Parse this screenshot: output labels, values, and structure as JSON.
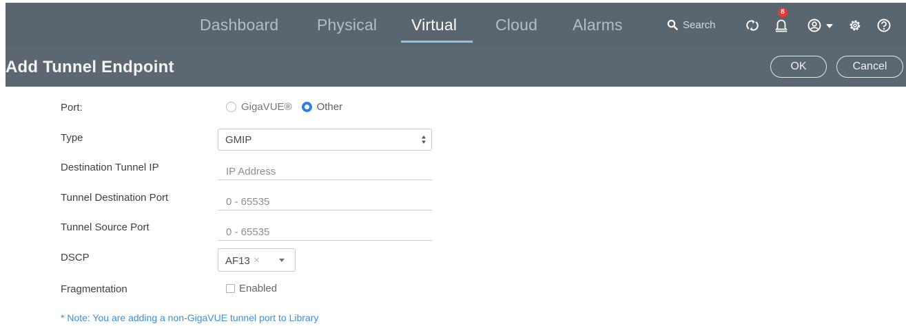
{
  "nav": {
    "tabs": [
      {
        "label": "Dashboard"
      },
      {
        "label": "Physical"
      },
      {
        "label": "Virtual"
      },
      {
        "label": "Cloud"
      },
      {
        "label": "Alarms"
      }
    ],
    "active_tab": "Virtual",
    "search_label": "Search",
    "notification_count": "8",
    "icons": [
      "search-icon",
      "refresh-icon",
      "bell-icon",
      "user-icon",
      "settings-icon",
      "help-icon"
    ]
  },
  "header": {
    "title": "Add Tunnel Endpoint",
    "ok_label": "OK",
    "cancel_label": "Cancel"
  },
  "form": {
    "port": {
      "label": "Port:",
      "options": [
        {
          "label": "GigaVUE®",
          "selected": false
        },
        {
          "label": "Other",
          "selected": true
        }
      ]
    },
    "type": {
      "label": "Type",
      "value": "GMIP"
    },
    "dest_ip": {
      "label": "Destination Tunnel IP",
      "placeholder": "IP Address"
    },
    "dest_port": {
      "label": "Tunnel Destination Port",
      "placeholder": "0 - 65535"
    },
    "source_port": {
      "label": "Tunnel Source Port",
      "placeholder": "0 - 65535"
    },
    "dscp": {
      "label": "DSCP",
      "value": "AF13",
      "clear": "×"
    },
    "fragmentation": {
      "label": "Fragmentation",
      "checkbox_label": "Enabled",
      "checked": false
    }
  },
  "note": "* Note: You are adding a non-GigaVUE tunnel port to Library",
  "colors": {
    "nav_bg": "#59656f",
    "title_bg": "#5b6771",
    "accent": "#8fc3e3",
    "radio_on": "#2f7fe0",
    "badge": "#e53935",
    "note": "#3f8fd0"
  }
}
